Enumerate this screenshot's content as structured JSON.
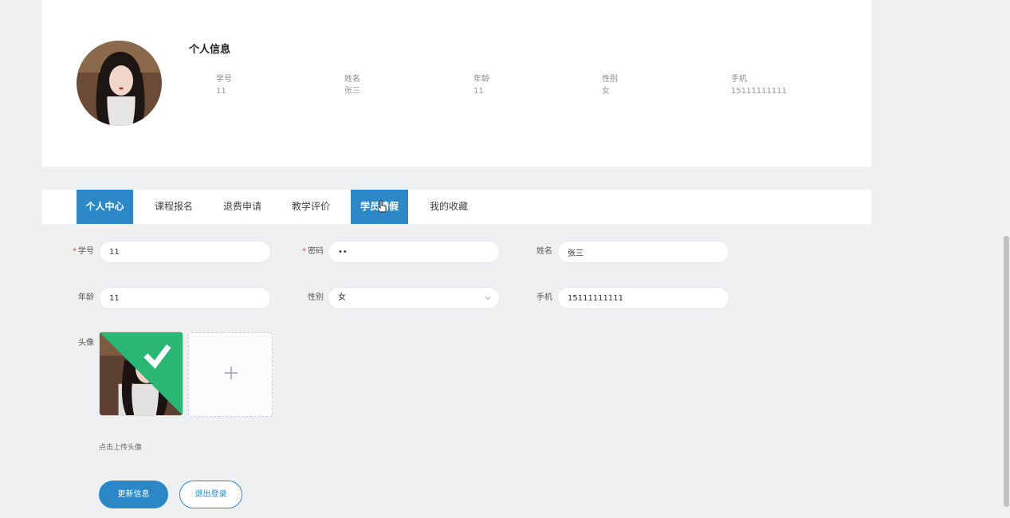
{
  "profile": {
    "title": "个人信息",
    "fields": [
      {
        "label": "学号",
        "value": "11"
      },
      {
        "label": "姓名",
        "value": "张三"
      },
      {
        "label": "年龄",
        "value": "11"
      },
      {
        "label": "性别",
        "value": "女"
      },
      {
        "label": "手机",
        "value": "15111111111"
      }
    ]
  },
  "tabs": [
    {
      "label": "个人中心"
    },
    {
      "label": "课程报名"
    },
    {
      "label": "退费申请"
    },
    {
      "label": "教学评价"
    },
    {
      "label": "学员请假"
    },
    {
      "label": "我的收藏"
    }
  ],
  "form": {
    "student_id": {
      "label": "学号",
      "value": "11",
      "required_mark": "*"
    },
    "password": {
      "label": "密码",
      "value": "••",
      "required_mark": "*"
    },
    "name": {
      "label": "姓名",
      "value": "张三"
    },
    "age": {
      "label": "年龄",
      "value": "11"
    },
    "gender": {
      "label": "性别",
      "value": "女"
    },
    "phone": {
      "label": "手机",
      "value": "15111111111"
    },
    "avatar": {
      "label": "头像",
      "hint": "点击上传头像"
    }
  },
  "buttons": {
    "update": "更新信息",
    "logout": "退出登录"
  },
  "colors": {
    "accent": "#2b87c6",
    "background": "#eef0f2",
    "success": "#2bb673"
  }
}
